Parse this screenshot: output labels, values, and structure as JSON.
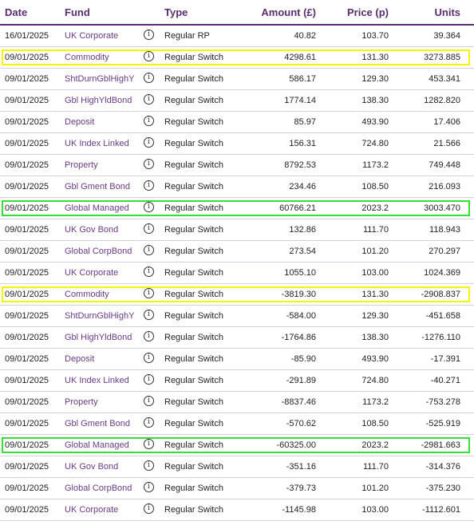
{
  "header": {
    "date": "Date",
    "fund": "Fund",
    "type": "Type",
    "amount": "Amount (£)",
    "price": "Price (p)",
    "units": "Units"
  },
  "info_icon": "info-circle-icon",
  "colors": {
    "header_text": "#5a2d6e",
    "fund_link": "#6b3a86",
    "highlight_yellow": "#f5f500",
    "highlight_green": "#33e033"
  },
  "rows": [
    {
      "date": "16/01/2025",
      "fund": "UK Corporate",
      "type": "Regular RP",
      "amount": "40.82",
      "price": "103.70",
      "units": "39.364",
      "highlight": ""
    },
    {
      "date": "09/01/2025",
      "fund": "Commodity",
      "type": "Regular Switch",
      "amount": "4298.61",
      "price": "131.30",
      "units": "3273.885",
      "highlight": "yellow"
    },
    {
      "date": "09/01/2025",
      "fund": "ShtDurnGblHighY",
      "type": "Regular Switch",
      "amount": "586.17",
      "price": "129.30",
      "units": "453.341",
      "highlight": ""
    },
    {
      "date": "09/01/2025",
      "fund": "Gbl HighYldBond",
      "type": "Regular Switch",
      "amount": "1774.14",
      "price": "138.30",
      "units": "1282.820",
      "highlight": ""
    },
    {
      "date": "09/01/2025",
      "fund": "Deposit",
      "type": "Regular Switch",
      "amount": "85.97",
      "price": "493.90",
      "units": "17.406",
      "highlight": ""
    },
    {
      "date": "09/01/2025",
      "fund": "UK Index Linked",
      "type": "Regular Switch",
      "amount": "156.31",
      "price": "724.80",
      "units": "21.566",
      "highlight": ""
    },
    {
      "date": "09/01/2025",
      "fund": "Property",
      "type": "Regular Switch",
      "amount": "8792.53",
      "price": "1173.2",
      "units": "749.448",
      "highlight": ""
    },
    {
      "date": "09/01/2025",
      "fund": "Gbl Gment Bond",
      "type": "Regular Switch",
      "amount": "234.46",
      "price": "108.50",
      "units": "216.093",
      "highlight": ""
    },
    {
      "date": "09/01/2025",
      "fund": "Global Managed",
      "type": "Regular Switch",
      "amount": "60766.21",
      "price": "2023.2",
      "units": "3003.470",
      "highlight": "green"
    },
    {
      "date": "09/01/2025",
      "fund": "UK Gov Bond",
      "type": "Regular Switch",
      "amount": "132.86",
      "price": "111.70",
      "units": "118.943",
      "highlight": ""
    },
    {
      "date": "09/01/2025",
      "fund": "Global CorpBond",
      "type": "Regular Switch",
      "amount": "273.54",
      "price": "101.20",
      "units": "270.297",
      "highlight": ""
    },
    {
      "date": "09/01/2025",
      "fund": "UK Corporate",
      "type": "Regular Switch",
      "amount": "1055.10",
      "price": "103.00",
      "units": "1024.369",
      "highlight": ""
    },
    {
      "date": "09/01/2025",
      "fund": "Commodity",
      "type": "Regular Switch",
      "amount": "-3819.30",
      "price": "131.30",
      "units": "-2908.837",
      "highlight": "yellow"
    },
    {
      "date": "09/01/2025",
      "fund": "ShtDurnGblHighY",
      "type": "Regular Switch",
      "amount": "-584.00",
      "price": "129.30",
      "units": "-451.658",
      "highlight": ""
    },
    {
      "date": "09/01/2025",
      "fund": "Gbl HighYldBond",
      "type": "Regular Switch",
      "amount": "-1764.86",
      "price": "138.30",
      "units": "-1276.110",
      "highlight": ""
    },
    {
      "date": "09/01/2025",
      "fund": "Deposit",
      "type": "Regular Switch",
      "amount": "-85.90",
      "price": "493.90",
      "units": "-17.391",
      "highlight": ""
    },
    {
      "date": "09/01/2025",
      "fund": "UK Index Linked",
      "type": "Regular Switch",
      "amount": "-291.89",
      "price": "724.80",
      "units": "-40.271",
      "highlight": ""
    },
    {
      "date": "09/01/2025",
      "fund": "Property",
      "type": "Regular Switch",
      "amount": "-8837.46",
      "price": "1173.2",
      "units": "-753.278",
      "highlight": ""
    },
    {
      "date": "09/01/2025",
      "fund": "Gbl Gment Bond",
      "type": "Regular Switch",
      "amount": "-570.62",
      "price": "108.50",
      "units": "-525.919",
      "highlight": ""
    },
    {
      "date": "09/01/2025",
      "fund": "Global Managed",
      "type": "Regular Switch",
      "amount": "-60325.00",
      "price": "2023.2",
      "units": "-2981.663",
      "highlight": "green"
    },
    {
      "date": "09/01/2025",
      "fund": "UK Gov Bond",
      "type": "Regular Switch",
      "amount": "-351.16",
      "price": "111.70",
      "units": "-314.376",
      "highlight": ""
    },
    {
      "date": "09/01/2025",
      "fund": "Global CorpBond",
      "type": "Regular Switch",
      "amount": "-379.73",
      "price": "101.20",
      "units": "-375.230",
      "highlight": ""
    },
    {
      "date": "09/01/2025",
      "fund": "UK Corporate",
      "type": "Regular Switch",
      "amount": "-1145.98",
      "price": "103.00",
      "units": "-1112.601",
      "highlight": ""
    }
  ]
}
